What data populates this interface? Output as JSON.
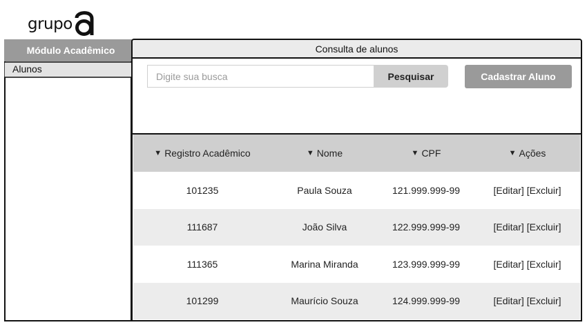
{
  "logo": {
    "text": "grupo",
    "mark_letter": "a"
  },
  "sidebar": {
    "header": "Módulo Acadêmico",
    "items": [
      {
        "label": "Alunos"
      }
    ]
  },
  "main": {
    "title": "Consulta de alunos",
    "search": {
      "placeholder": "Digite sua busca",
      "value": "",
      "button_label": "Pesquisar"
    },
    "add_button_label": "Cadastrar Aluno",
    "table": {
      "headers": [
        "Registro Acadêmico",
        "Nome",
        "CPF",
        "Ações"
      ],
      "rows": [
        {
          "registro": "101235",
          "nome": "Paula Souza",
          "cpf": "121.999.999-99",
          "edit": "[Editar]",
          "delete": "[Excluir]"
        },
        {
          "registro": "111687",
          "nome": "João Silva",
          "cpf": "122.999.999-99",
          "edit": "[Editar]",
          "delete": "[Excluir]"
        },
        {
          "registro": "111365",
          "nome": "Marina Miranda",
          "cpf": "123.999.999-99",
          "edit": "[Editar]",
          "delete": "[Excluir]"
        },
        {
          "registro": "101299",
          "nome": "Maurício Souza",
          "cpf": "124.999.999-99",
          "edit": "[Editar]",
          "delete": "[Excluir]"
        }
      ]
    }
  },
  "icons": {
    "sort": "caret-down-icon"
  },
  "colors": {
    "header_gray": "#9a9a9a",
    "table_header": "#cfcfcf",
    "row_alt": "#ececec"
  }
}
